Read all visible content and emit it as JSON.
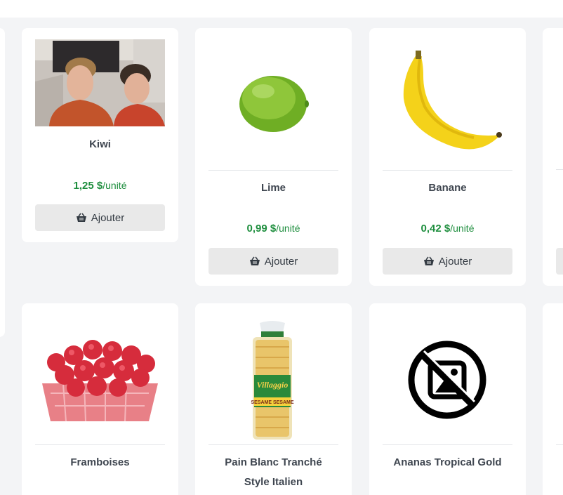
{
  "products": [
    {
      "name": "Kiwi",
      "price": "1,25 $",
      "unit": "/unité",
      "button": "Ajouter"
    },
    {
      "name": "Lime",
      "price": "0,99 $",
      "unit": "/unité",
      "button": "Ajouter"
    },
    {
      "name": "Banane",
      "price": "0,42 $",
      "unit": "/unité",
      "button": "Ajouter"
    },
    {
      "name": "Framboises"
    },
    {
      "name": "Pain Blanc Tranché Style Italien"
    },
    {
      "name": "Ananas Tropical Gold"
    }
  ],
  "bread_bag": {
    "brand": "Villaggio",
    "flavor": "SESAME SESAME"
  },
  "colors": {
    "price": "#1e8e3e",
    "button_bg": "#e9e9e9",
    "page_bg": "#f3f4f6"
  }
}
